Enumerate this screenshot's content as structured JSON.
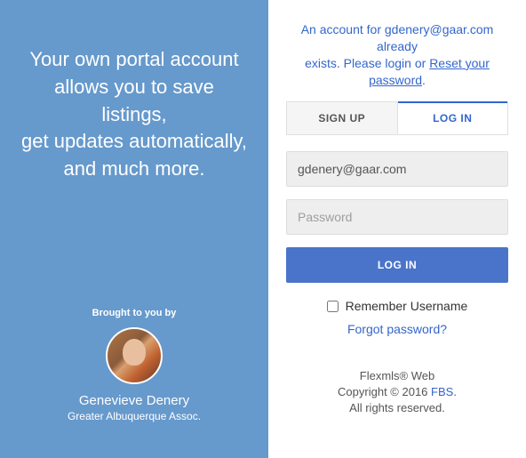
{
  "left": {
    "headline_l1": "Your own portal account",
    "headline_l2": "allows you to save listings,",
    "headline_l3": "get updates automatically,",
    "headline_l4": "and much more.",
    "brought_by": "Brought to you by",
    "agent_name": "Genevieve Denery",
    "agent_org": "Greater Albuquerque Assoc."
  },
  "notice": {
    "line1_a": "An account for ",
    "email": "gdenery@gaar.com",
    "line1_b": " already",
    "line2_a": "exists. Please login or ",
    "reset": "Reset your password",
    "period": "."
  },
  "tabs": {
    "signup": "SIGN UP",
    "login": "LOG IN"
  },
  "form": {
    "email_value": "gdenery@gaar.com",
    "password_placeholder": "Password",
    "submit": "LOG IN",
    "remember": "Remember Username",
    "forgot": "Forgot password?"
  },
  "footer": {
    "product": "Flexmls® Web",
    "copyright_a": "Copyright © 2016 ",
    "fbs": "FBS",
    "copyright_b": ".",
    "rights": "All rights reserved."
  }
}
